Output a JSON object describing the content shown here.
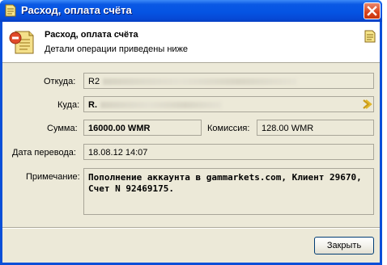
{
  "window": {
    "title": "Расход, оплата счёта"
  },
  "header": {
    "title": "Расход, оплата счёта",
    "subtitle": "Детали операции приведены ниже"
  },
  "form": {
    "from_label": "Откуда:",
    "from_value": "R2",
    "to_label": "Куда:",
    "to_value": "R.",
    "amount_label": "Сумма:",
    "amount_value": "16000.00 WMR",
    "commission_label": "Комиссия:",
    "commission_value": "128.00 WMR",
    "date_label": "Дата перевода:",
    "date_value": "18.08.12 14:07",
    "note_label": "Примечание:",
    "note_value": "Пополнение аккаунта в gammarkets.com, Клиент 29670, Счет N 92469175."
  },
  "footer": {
    "close_label": "Закрыть"
  },
  "colors": {
    "titlebar": "#0554e3",
    "client": "#ece9d8",
    "close_button": "#d8421b"
  },
  "icons": {
    "title": "invoice-icon",
    "header": "invoice-outgoing-icon",
    "header_right": "invoice-small-icon",
    "to_arrow": "chevron-right-icon",
    "close": "close-icon"
  }
}
